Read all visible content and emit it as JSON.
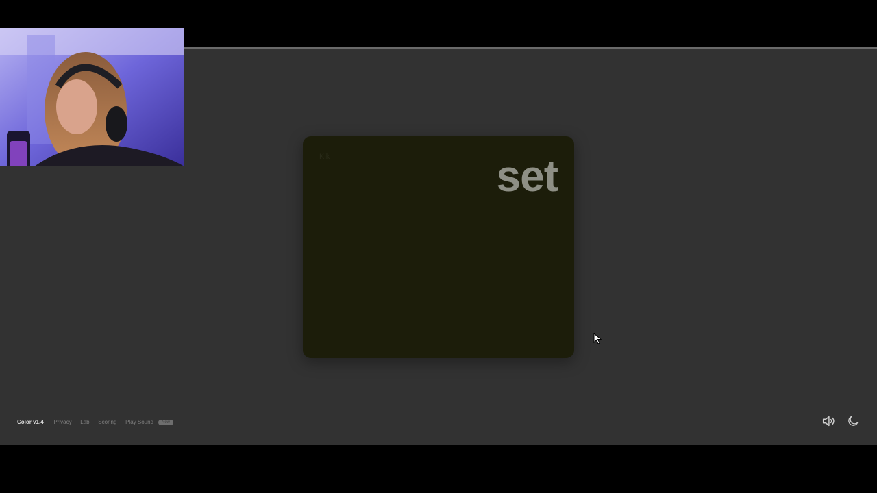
{
  "game": {
    "small_label": "Kik",
    "word": "set",
    "card_color": "#1c1d0a",
    "word_color": "#8e8f85"
  },
  "footer": {
    "brand": "Color v1.4",
    "links": [
      "Privacy",
      "Lab",
      "Scoring",
      "Play Sound"
    ],
    "badge": "New",
    "sound_icon": "speaker-icon",
    "theme_icon": "moon-icon"
  },
  "colors": {
    "page_background": "#323232",
    "letterbox": "#000000"
  }
}
